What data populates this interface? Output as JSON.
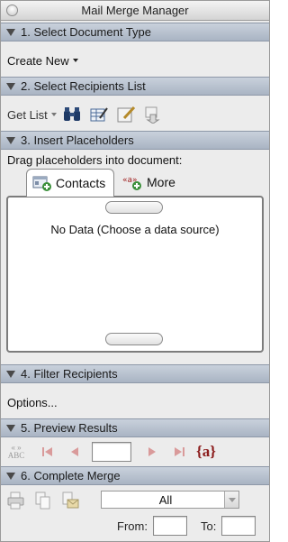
{
  "window": {
    "title": "Mail Merge Manager"
  },
  "sections": {
    "s1": {
      "title": "1. Select Document Type",
      "create_new": "Create New"
    },
    "s2": {
      "title": "2. Select Recipients List",
      "get_list": "Get List"
    },
    "s3": {
      "title": "3. Insert Placeholders",
      "instruction": "Drag placeholders into document:",
      "tabs": [
        {
          "label": "Contacts"
        },
        {
          "label": "More"
        }
      ],
      "empty_message": "No Data (Choose a data source)"
    },
    "s4": {
      "title": "4. Filter Recipients",
      "options": "Options..."
    },
    "s5": {
      "title": "5. Preview Results",
      "view_merged_icon_text": "ABC",
      "record_number": "",
      "field_icon_text": "{a}"
    },
    "s6": {
      "title": "6. Complete Merge",
      "range_select": "All",
      "from_label": "From:",
      "to_label": "To:",
      "from_value": "",
      "to_value": ""
    }
  },
  "colors": {
    "header_bg": "#b3bdcb",
    "panel_bg": "#ececec",
    "accent_red": "#c0392b",
    "icon_blue": "#2b4a7a"
  }
}
